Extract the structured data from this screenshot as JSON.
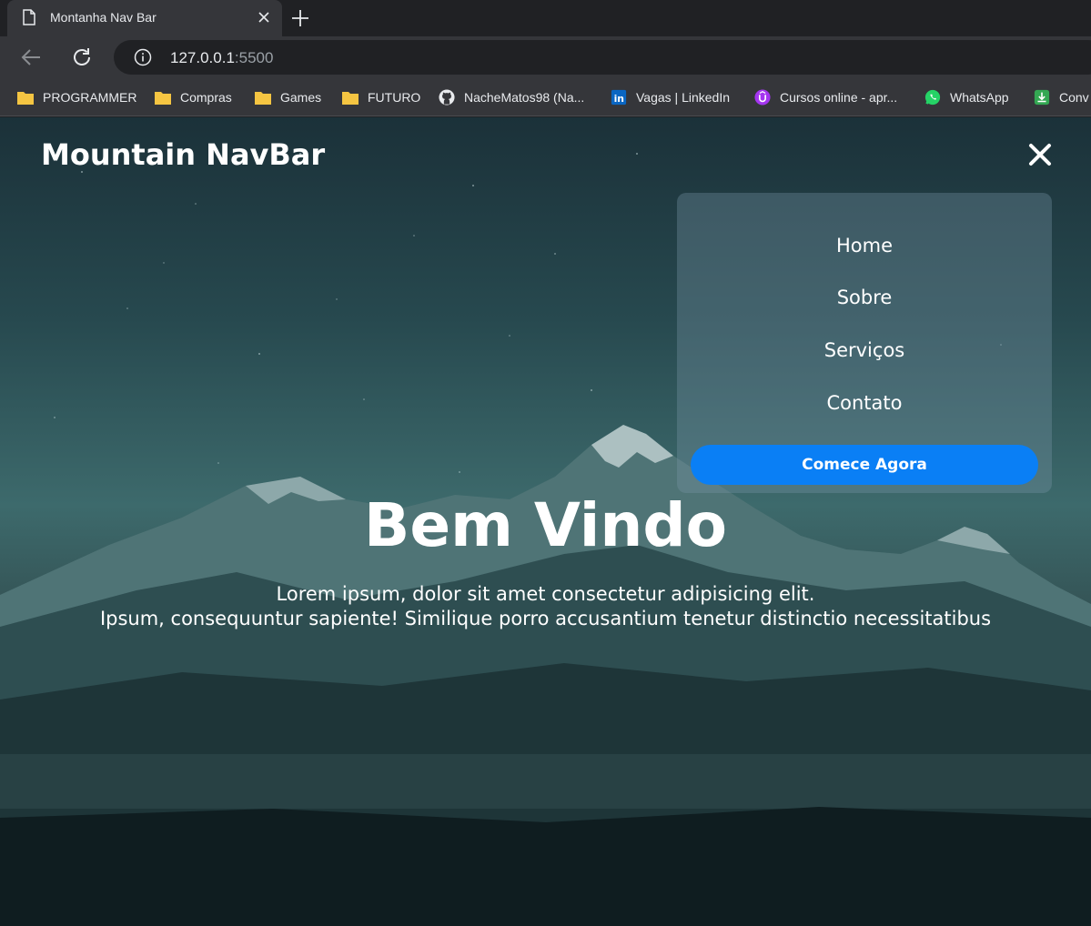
{
  "browser": {
    "tab_title": "Montanha Nav Bar",
    "url_host": "127.0.0.1",
    "url_port": ":5500",
    "bookmarks": [
      {
        "label": "PROGRAMMER",
        "icon": "folder-icon"
      },
      {
        "label": "Compras",
        "icon": "folder-icon"
      },
      {
        "label": "Games",
        "icon": "folder-icon"
      },
      {
        "label": "FUTURO",
        "icon": "folder-icon"
      },
      {
        "label": "NacheMatos98 (Na...",
        "icon": "github-icon"
      },
      {
        "label": "Vagas | LinkedIn",
        "icon": "linkedin-icon"
      },
      {
        "label": "Cursos online - apr...",
        "icon": "udemy-icon"
      },
      {
        "label": "WhatsApp",
        "icon": "whatsapp-icon"
      },
      {
        "label": "Conv",
        "icon": "download-icon"
      }
    ]
  },
  "page": {
    "logo": "Mountain NavBar",
    "menu": {
      "items": [
        "Home",
        "Sobre",
        "Serviços",
        "Contato"
      ],
      "cta": "Comece Agora"
    },
    "hero": {
      "title": "Bem Vindo",
      "line1": "Lorem ipsum, dolor sit amet consectetur adipisicing elit.",
      "line2": "Ipsum, consequuntur sapiente! Similique porro accusantium tenetur distinctio necessitatibus"
    }
  },
  "colors": {
    "accent": "#0a7ff5",
    "chrome_dark": "#202124",
    "chrome": "#35363a",
    "folder": "#f5c542"
  }
}
